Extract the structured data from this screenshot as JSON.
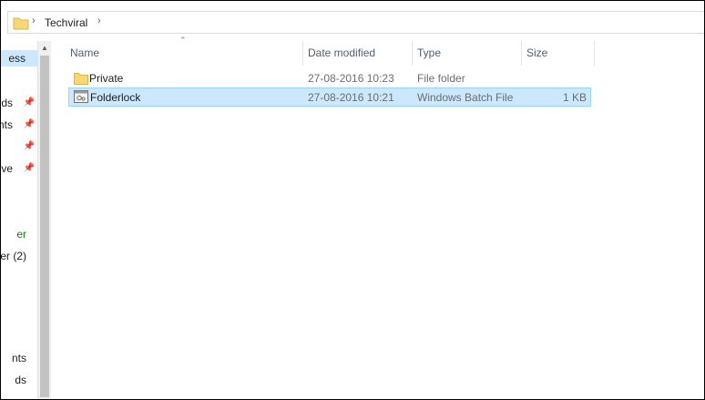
{
  "address": {
    "crumb": "Techviral",
    "sep_icon": "chevron-right-icon"
  },
  "nav": {
    "items": [
      {
        "label": "ess",
        "pinned": false,
        "selected": true
      },
      {
        "label": "ds",
        "pinned": true
      },
      {
        "label": "nts",
        "pinned": true
      },
      {
        "label": "",
        "pinned": true
      },
      {
        "label": "rive",
        "pinned": true
      },
      {
        "label": "er",
        "color": "#107c10"
      },
      {
        "label": "er (2)"
      },
      {
        "label": "nts"
      },
      {
        "label": "ds"
      }
    ]
  },
  "columns": {
    "name": "Name",
    "date": "Date modified",
    "type": "Type",
    "size": "Size"
  },
  "files": [
    {
      "name": "Private",
      "date": "27-08-2016 10:23",
      "type": "File folder",
      "size": "",
      "icon": "folder-icon",
      "selected": false
    },
    {
      "name": "Folderlock",
      "date": "27-08-2016 10:21",
      "type": "Windows Batch File",
      "size": "1 KB",
      "icon": "batch-file-icon",
      "selected": true
    }
  ],
  "colors": {
    "selection": "#cce8ff",
    "selection_border": "#99d1ff",
    "header_text": "#4c607a",
    "folder": "#f8d775"
  }
}
